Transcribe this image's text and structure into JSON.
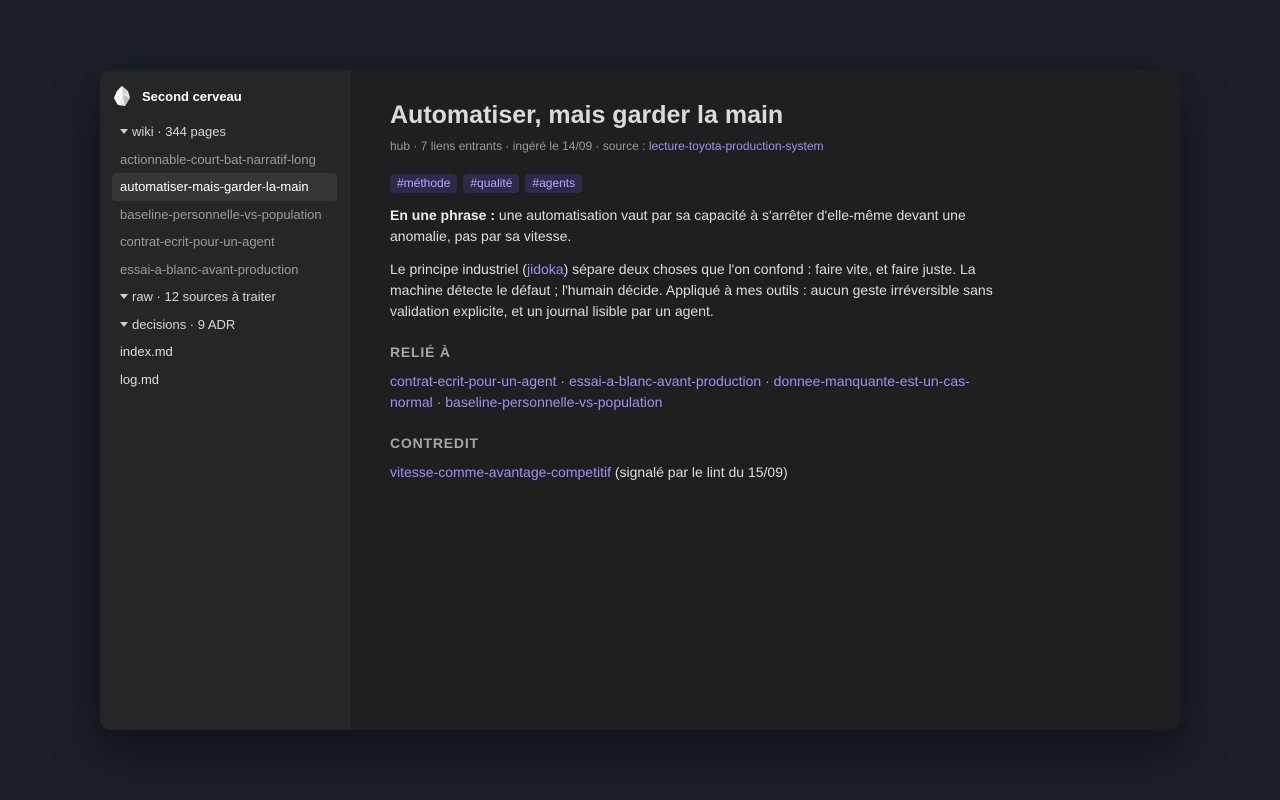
{
  "vault": {
    "name": "Second cerveau"
  },
  "sidebar": {
    "wiki_folder": "wiki · 344 pages",
    "wiki_files": [
      "actionnable-court-bat-narratif-long",
      "automatiser-mais-garder-la-main",
      "baseline-personnelle-vs-population",
      "contrat-ecrit-pour-un-agent",
      "essai-a-blanc-avant-production"
    ],
    "raw_folder": "raw · 12 sources à traiter",
    "decisions_folder": "decisions · 9 ADR",
    "root_files": [
      "index.md",
      "log.md"
    ],
    "active_file": "automatiser-mais-garder-la-main"
  },
  "note": {
    "title": "Automatiser, mais garder la main",
    "meta_prefix": "hub · 7 liens entrants · ingéré le 14/09 · source : ",
    "meta_source": "lecture-toyota-production-system",
    "tags": [
      "#méthode",
      "#qualité",
      "#agents"
    ],
    "summary_label": "En une phrase :",
    "summary_text": " une automatisation vaut par sa capacité à s'arrêter d'elle-même devant une anomalie, pas par sa vitesse.",
    "para_before": "Le principe industriel (",
    "para_link": "jidoka",
    "para_after": ") sépare deux choses que l'on confond : faire vite, et faire juste. La machine détecte le défaut ; l'humain décide. Appliqué à mes outils : aucun geste irréversible sans validation explicite, et un journal lisible par un agent.",
    "related_heading": "RELIÉ À",
    "related_links": [
      "contrat-ecrit-pour-un-agent",
      "essai-a-blanc-avant-production",
      "donnee-manquante-est-un-cas-normal",
      "baseline-personnelle-vs-population"
    ],
    "related_sep": " · ",
    "contradicts_heading": "CONTREDIT",
    "contradicts_link": "vitesse-comme-avantage-competitif",
    "contradicts_note": " (signalé par le lint du 15/09)"
  },
  "colors": {
    "background": "#1b1f27",
    "accent": "#a68af9",
    "tag_bg": "#2f2a4a"
  }
}
